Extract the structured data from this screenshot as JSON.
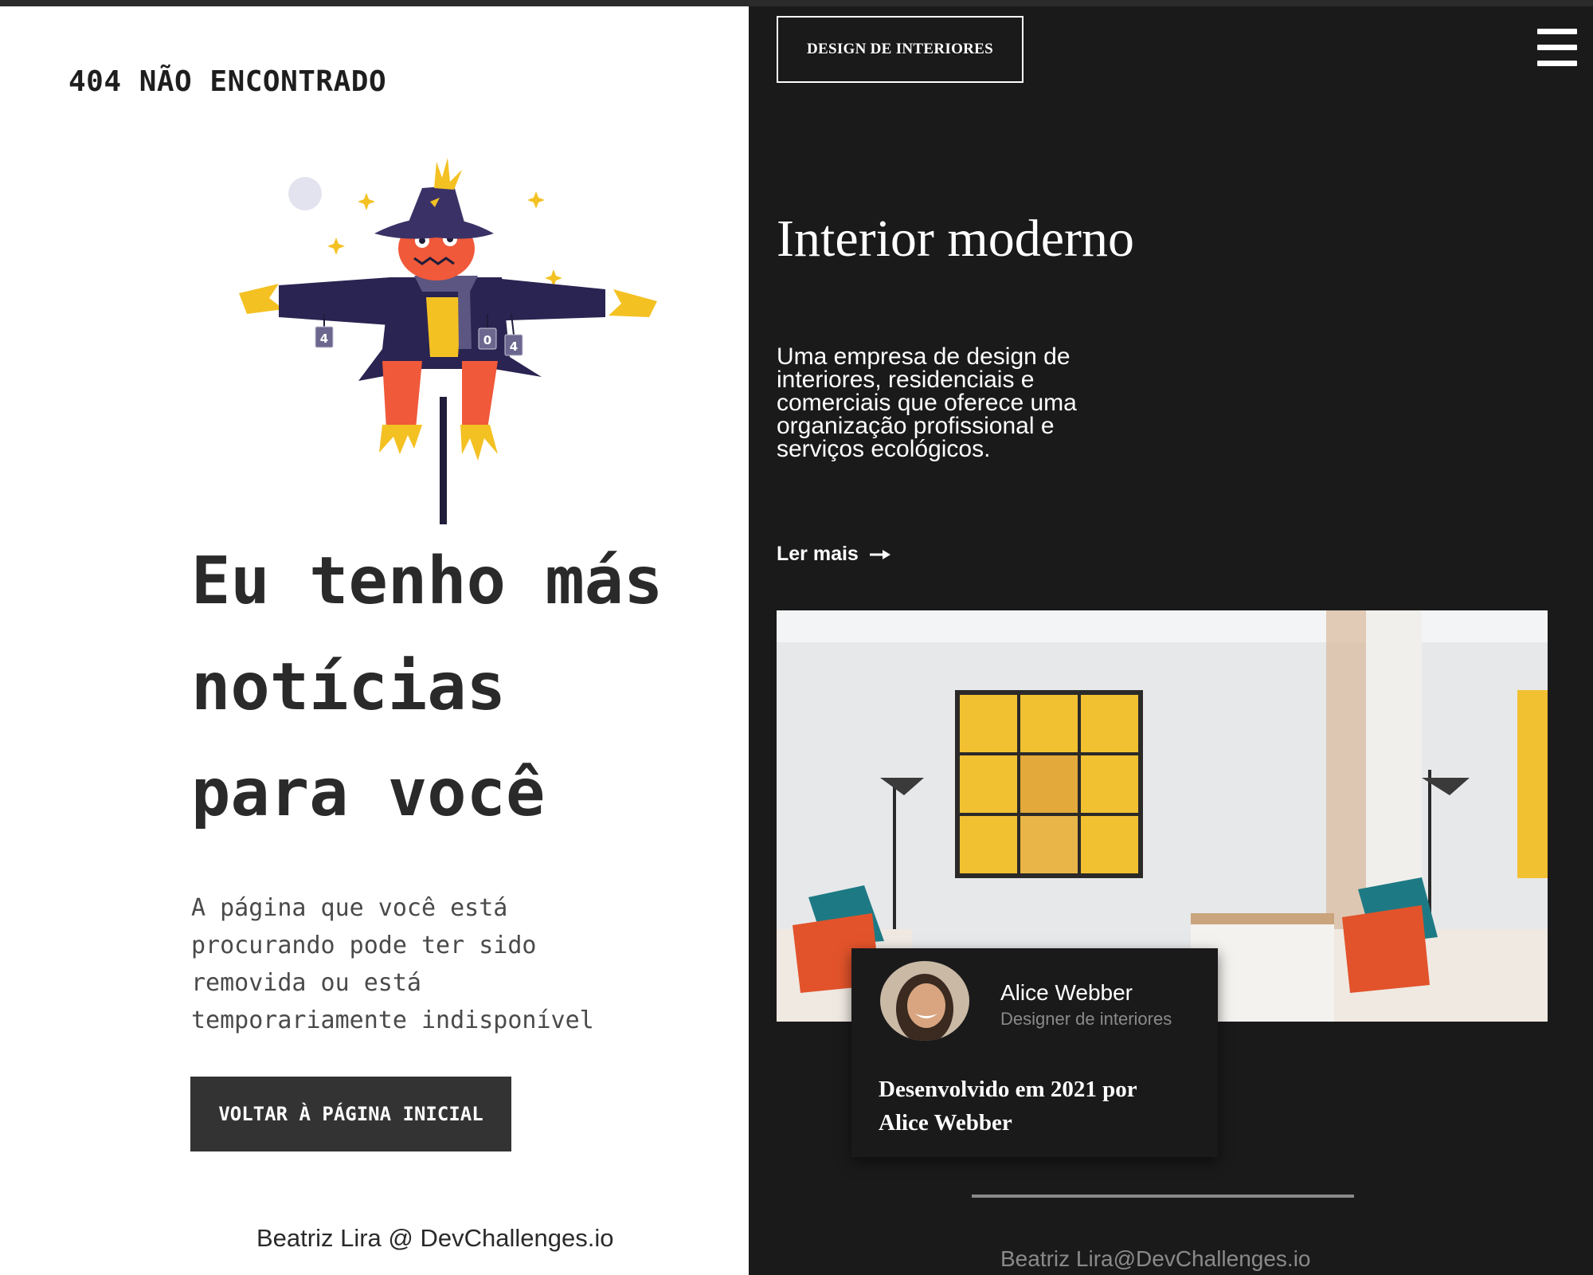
{
  "left_panel": {
    "title": "404 NÃO ENCONTRADO",
    "illustration_icon": "scarecrow-404-icon",
    "headline_lines": [
      "Eu tenho más",
      "notícias",
      "para você"
    ],
    "description_lines": [
      "A página que você está",
      "procurando pode ter sido",
      "removida ou está",
      "temporariamente indisponível"
    ],
    "button_label": "VOLTAR À PÁGINA INICIAL",
    "footer": "Beatriz Lira @ DevChallenges.io",
    "colors": {
      "background": "#ffffff",
      "text": "#2a2a2a",
      "button": "#333333",
      "scarecrow_hat": "#3a3266",
      "scarecrow_face": "#f0593a",
      "straw": "#f4c123"
    }
  },
  "right_panel": {
    "logo": "DESIGN DE INTERIORES",
    "menu_icon": "hamburger-menu-icon",
    "title": "Interior moderno",
    "description_lines": [
      "Uma empresa de design de",
      "interiores, residenciais e",
      "comerciais que oferece uma",
      "organização profissional e",
      "serviços ecológicos."
    ],
    "read_more": "Ler mais",
    "read_more_icon": "arrow-right-icon",
    "photo_icon": "living-room-photo",
    "card": {
      "avatar_icon": "avatar-photo",
      "name": "Alice Webber",
      "role": "Designer de interiores",
      "credit_lines": [
        "Desenvolvido em 2021 por",
        "Alice Webber"
      ]
    },
    "footer": "Beatriz Lira@DevChallenges.io",
    "colors": {
      "background": "#1b1a1b",
      "text": "#ffffff",
      "muted": "#8a8a8a"
    }
  }
}
